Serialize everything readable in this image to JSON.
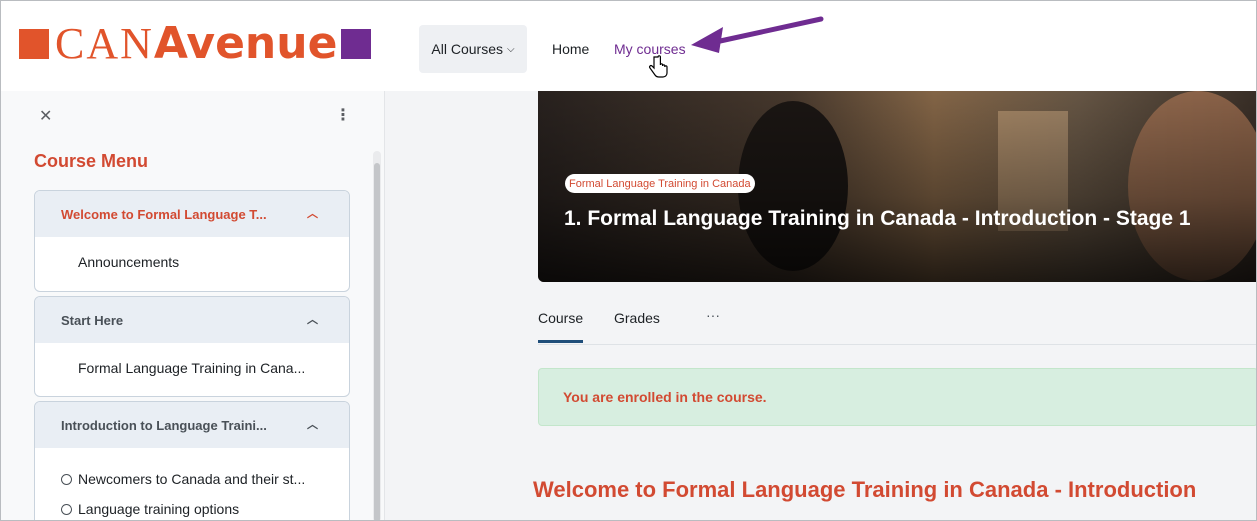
{
  "brand": {
    "logo_text_can": "CAN",
    "logo_text_avenue": "Avenue",
    "colors": {
      "orange": "#e1542b",
      "purple": "#6f2c91",
      "accent_red": "#d24a32"
    }
  },
  "nav": {
    "all_courses": "All Courses",
    "home": "Home",
    "my_courses": "My courses"
  },
  "drawer": {
    "title": "Course Menu",
    "sections": [
      {
        "title": "Welcome to Formal Language T...",
        "items": [
          "Announcements"
        ]
      },
      {
        "title": "Start Here",
        "items": [
          "Formal Language Training in Cana..."
        ]
      },
      {
        "title": "Introduction to Language Traini...",
        "items": [
          "Newcomers to Canada and their st...",
          "Language training options"
        ]
      }
    ]
  },
  "course": {
    "category_pill": "Formal Language Training in Canada",
    "title": "1. Formal Language Training in Canada - Introduction - Stage 1",
    "tabs": {
      "course": "Course",
      "grades": "Grades",
      "more": "···"
    },
    "alert": "You are enrolled in the course.",
    "welcome_heading": "Welcome to Formal Language Training in Canada - Introduction"
  }
}
